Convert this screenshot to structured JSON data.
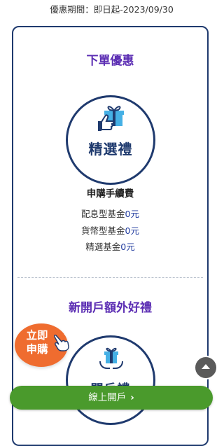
{
  "promo": {
    "period": "優惠期間：即日起-2023/09/30"
  },
  "order_offer": {
    "title": "下單優惠",
    "badge": "精選禮",
    "fee_heading": "申購手續費",
    "fees": [
      {
        "name": "配息型基金",
        "value": "0元"
      },
      {
        "name": "貨幣型基金",
        "value": "0元"
      },
      {
        "name": "精選基金",
        "value": "0元"
      }
    ]
  },
  "new_account_offer": {
    "title": "新開戶額外好禮",
    "badge_partial": "開戶禮"
  },
  "floating": {
    "buy_now": "立即申購"
  },
  "cta": {
    "label": "線上開戶",
    "chevron": "›"
  },
  "colors": {
    "navy": "#1f3a6e",
    "purple": "#5b2db3",
    "orange": "#ef6c2f",
    "green": "#4a9a2c",
    "sky": "#45b0e5"
  }
}
